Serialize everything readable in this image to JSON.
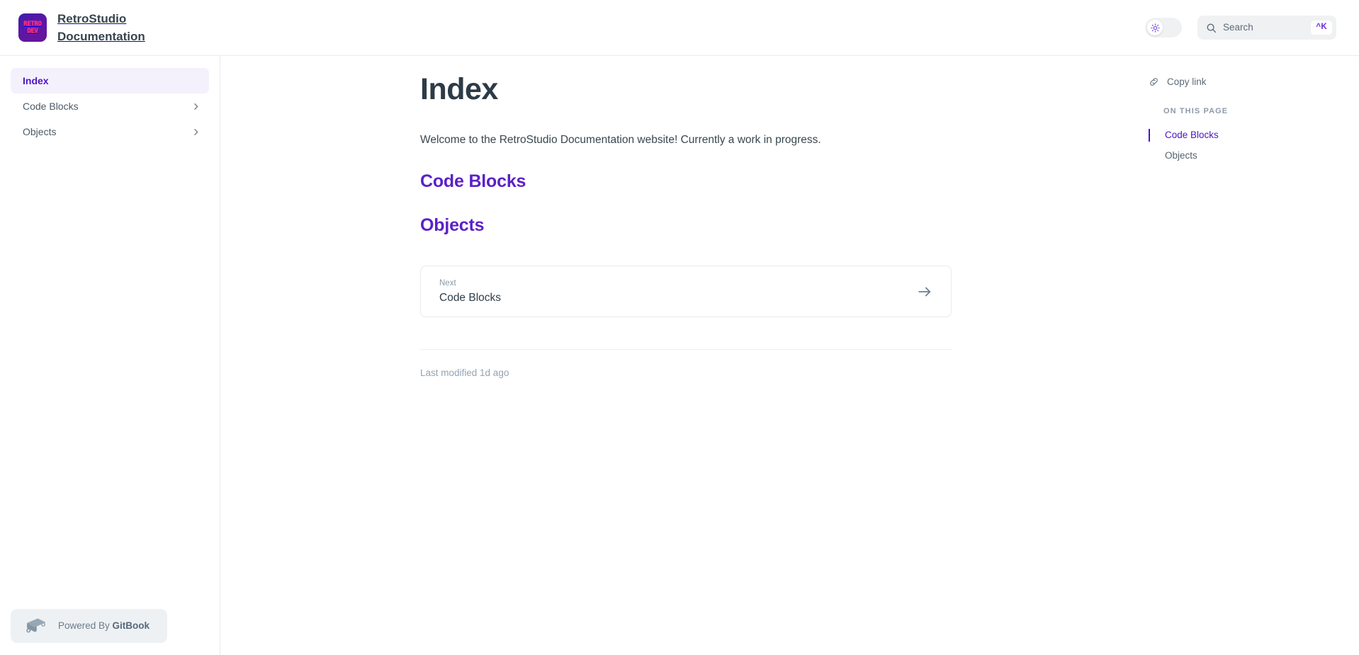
{
  "header": {
    "logo_line1": "RETRO",
    "logo_line2": "DEV",
    "title": "RetroStudio Documentation",
    "theme_toggle_icon": "sun-icon",
    "search": {
      "placeholder": "Search",
      "shortcut": "^K",
      "icon": "search-icon"
    }
  },
  "sidebar": {
    "items": [
      {
        "label": "Index",
        "active": true,
        "has_chevron": false
      },
      {
        "label": "Code Blocks",
        "active": false,
        "has_chevron": true
      },
      {
        "label": "Objects",
        "active": false,
        "has_chevron": true
      }
    ],
    "powered_by": {
      "prefix": "Powered By ",
      "brand": "GitBook",
      "icon": "gitbook-logo-icon"
    }
  },
  "main": {
    "title": "Index",
    "intro": "Welcome to the RetroStudio Documentation website! Currently a work in progress.",
    "sections": [
      {
        "label": "Code Blocks"
      },
      {
        "label": "Objects"
      }
    ],
    "next_card": {
      "kicker": "Next",
      "title": "Code Blocks",
      "arrow_icon": "arrow-right-icon"
    },
    "last_modified": "Last modified 1d ago"
  },
  "rail": {
    "copy_link": {
      "label": "Copy link",
      "icon": "link-icon"
    },
    "on_this_page_heading": "ON THIS PAGE",
    "toc": [
      {
        "label": "Code Blocks",
        "active": true
      },
      {
        "label": "Objects",
        "active": false
      }
    ]
  },
  "colors": {
    "accent": "#4d14c4",
    "heading_link": "#5b21c7",
    "logo_pink": "#ff2e7e",
    "text": "#2f3b45",
    "muted": "#8b98a5"
  }
}
